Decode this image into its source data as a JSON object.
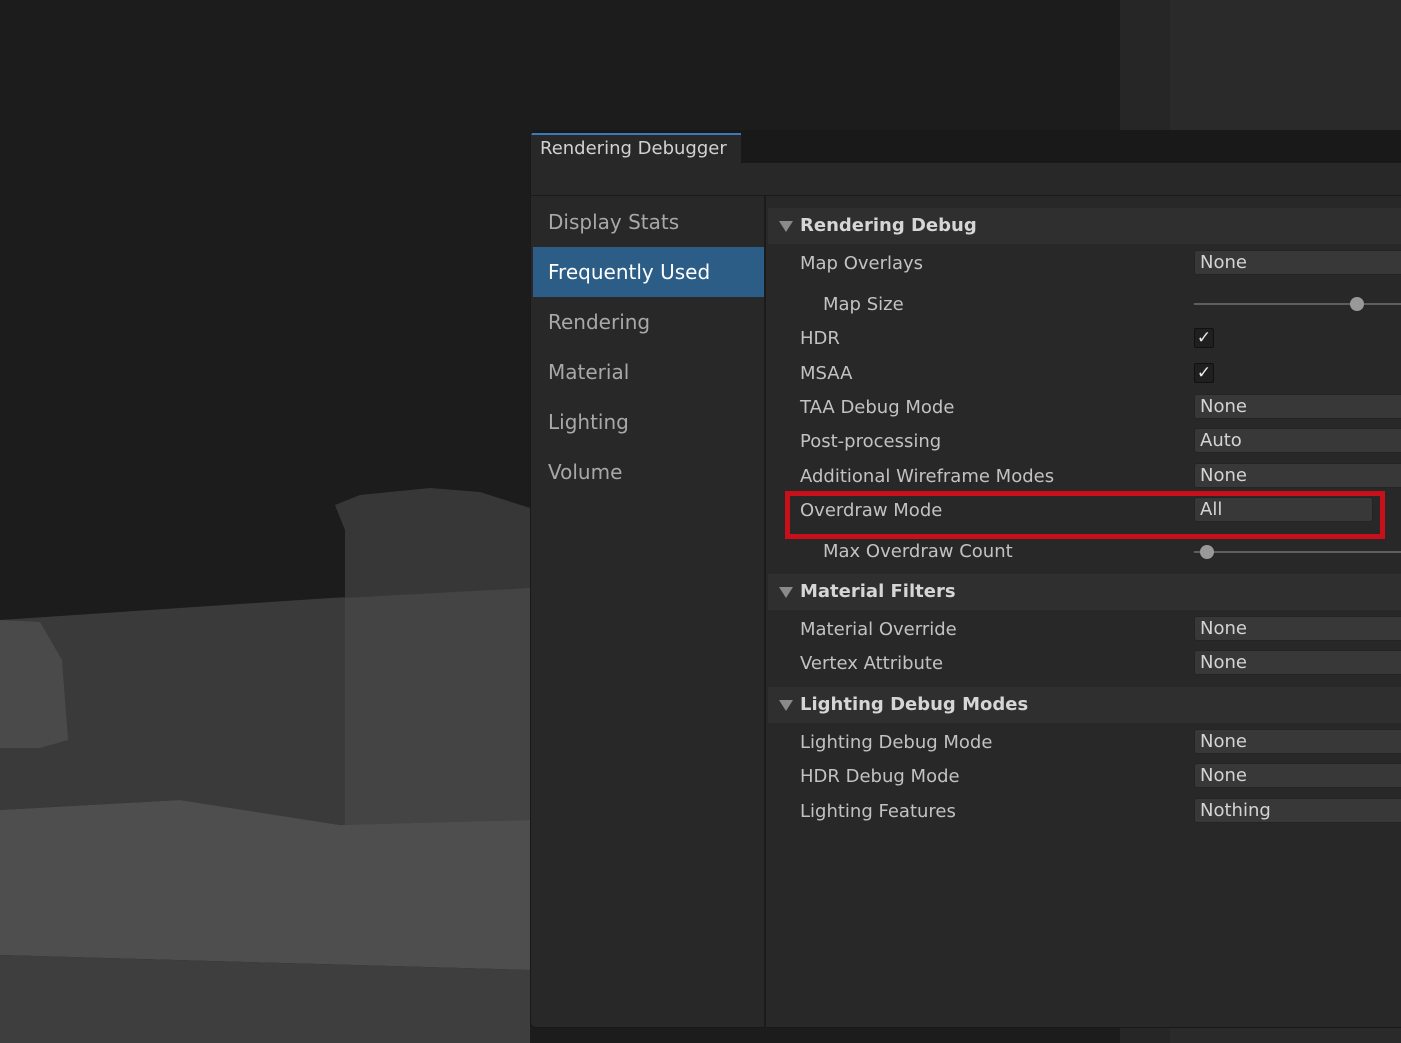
{
  "window": {
    "tab_title": "Rendering Debugger"
  },
  "sidebar": {
    "items": [
      {
        "label": "Display Stats",
        "active": false
      },
      {
        "label": "Frequently Used",
        "active": true
      },
      {
        "label": "Rendering",
        "active": false
      },
      {
        "label": "Material",
        "active": false
      },
      {
        "label": "Lighting",
        "active": false
      },
      {
        "label": "Volume",
        "active": false
      }
    ]
  },
  "sections": {
    "rendering_debug": {
      "title": "Rendering Debug",
      "map_overlays": {
        "label": "Map Overlays",
        "value": "None"
      },
      "map_size": {
        "label": "Map Size",
        "slider_fraction": 0.74
      },
      "hdr": {
        "label": "HDR",
        "checked": true,
        "glyph": "✓"
      },
      "msaa": {
        "label": "MSAA",
        "checked": true,
        "glyph": "✓"
      },
      "taa_debug_mode": {
        "label": "TAA Debug Mode",
        "value": "None"
      },
      "post_processing": {
        "label": "Post-processing",
        "value": "Auto"
      },
      "additional_wireframe_modes": {
        "label": "Additional Wireframe Modes",
        "value": "None"
      },
      "overdraw_mode": {
        "label": "Overdraw Mode",
        "value": "All"
      },
      "max_overdraw_count": {
        "label": "Max Overdraw Count",
        "slider_fraction": 0.06
      }
    },
    "material_filters": {
      "title": "Material Filters",
      "material_override": {
        "label": "Material Override",
        "value": "None"
      },
      "vertex_attribute": {
        "label": "Vertex Attribute",
        "value": "None"
      }
    },
    "lighting_debug_modes": {
      "title": "Lighting Debug Modes",
      "lighting_debug_mode": {
        "label": "Lighting Debug Mode",
        "value": "None"
      },
      "hdr_debug_mode": {
        "label": "HDR Debug Mode",
        "value": "None"
      },
      "lighting_features": {
        "label": "Lighting Features",
        "value": "Nothing"
      }
    }
  },
  "colors": {
    "accent": "#2c5d87",
    "highlight": "#c8101a",
    "panel_bg": "#282828"
  }
}
